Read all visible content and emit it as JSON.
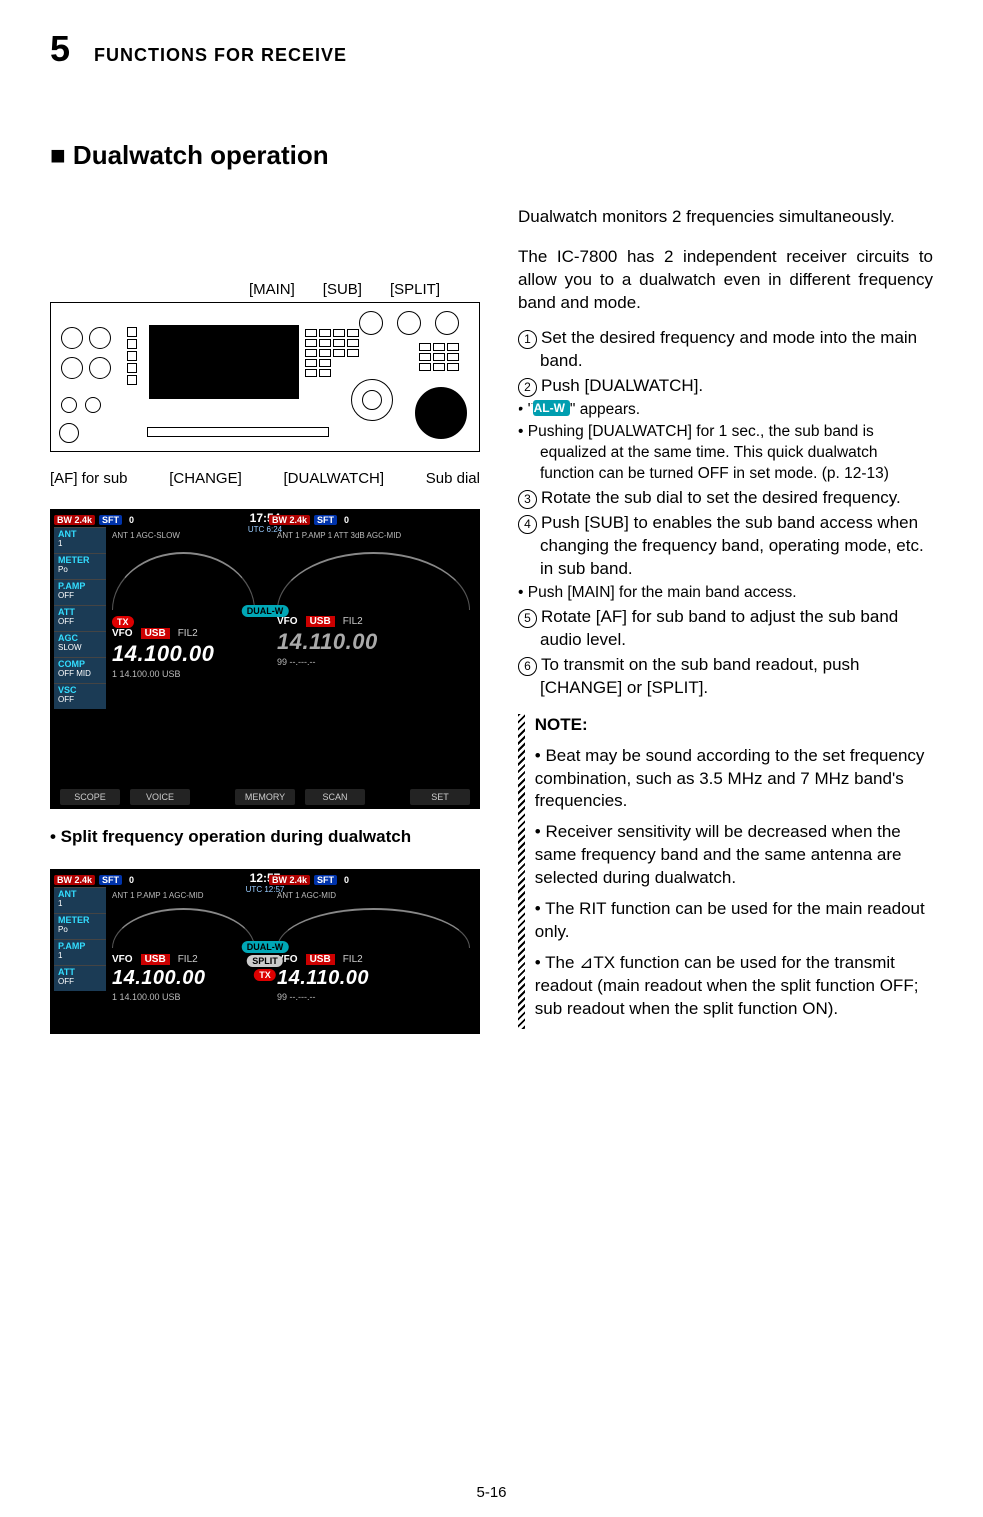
{
  "chapter": {
    "number": "5",
    "heading": "FUNCTIONS FOR RECEIVE"
  },
  "section_title": "■ Dualwatch operation",
  "labels_top": {
    "main": "[MAIN]",
    "sub": "[SUB]",
    "split": "[SPLIT]"
  },
  "labels_bot": {
    "af": "[AF] for sub",
    "change": "[CHANGE]",
    "dualwatch": "[DUALWATCH]",
    "subdial": "Sub dial"
  },
  "lcd1": {
    "clock": "17:54",
    "clock_sub": "UTC  6:24",
    "left": {
      "top": [
        "BW 2.4k",
        "SFT",
        "0"
      ],
      "info": "ANT 1               AGC-SLOW",
      "side": [
        {
          "lab": "ANT",
          "val": "1"
        },
        {
          "lab": "METER",
          "val": "Po"
        },
        {
          "lab": "P.AMP",
          "val": "OFF"
        },
        {
          "lab": "ATT",
          "val": "OFF"
        },
        {
          "lab": "AGC",
          "val": "SLOW"
        },
        {
          "lab": "COMP",
          "val": "OFF MID"
        },
        {
          "lab": "VSC",
          "val": "OFF"
        }
      ],
      "tx": "TX",
      "mode": {
        "vfo": "VFO",
        "usb": "USB",
        "fil": "FIL2"
      },
      "freq": "14.100.00",
      "sub": "1  14.100.00  USB"
    },
    "right": {
      "top": [
        "BW 2.4k",
        "SFT",
        "0"
      ],
      "info": "ANT 1      P.AMP 1  ATT 3dB      AGC-MID",
      "mode": {
        "vfo": "VFO",
        "usb": "USB",
        "fil": "FIL2"
      },
      "freq": "14.110.00",
      "sub": "99  --.---.--"
    },
    "mid_badge": "DUAL-W",
    "bottombar": [
      "SCOPE",
      "VOICE",
      "",
      "MEMORY",
      "SCAN",
      "",
      "SET"
    ]
  },
  "split_caption": "• Split frequency operation during dualwatch",
  "lcd2": {
    "clock": "12:57",
    "clock_sub": "UTC 12:57",
    "left": {
      "top": [
        "BW 2.4k",
        "SFT",
        "0"
      ],
      "info": "ANT 1      P.AMP 1         AGC-MID",
      "side": [
        {
          "lab": "ANT",
          "val": "1"
        },
        {
          "lab": "METER",
          "val": "Po"
        },
        {
          "lab": "P.AMP",
          "val": "1"
        },
        {
          "lab": "ATT",
          "val": "OFF"
        }
      ],
      "mode": {
        "vfo": "VFO",
        "usb": "USB",
        "fil": "FIL2"
      },
      "freq": "14.100.00",
      "sub": "1  14.100.00  USB"
    },
    "right": {
      "top": [
        "BW 2.4k",
        "SFT",
        "0"
      ],
      "info": "ANT 1                     AGC-MID",
      "mode": {
        "vfo": "VFO",
        "usb": "USB",
        "fil": "FIL2"
      },
      "freq": "14.110.00",
      "sub": "99  --.---.--"
    },
    "mid_badge_top": "DUAL-W",
    "mid_badge_bottom": "SPLIT",
    "tx": "TX"
  },
  "intro1": "Dualwatch monitors 2 frequencies simultaneously.",
  "intro2": "The IC-7800 has 2 independent receiver circuits to allow you to a dualwatch even in different frequency band and mode.",
  "steps": {
    "s1": "Set the desired frequency and mode into the main band.",
    "s2": "Push [DUALWATCH].",
    "s2a": "\" appears.",
    "s2aprefix": "\"",
    "s2a_badge": "DUAL-W",
    "s2b": "Pushing [DUALWATCH] for 1 sec., the sub band is equalized at the same time. This quick dualwatch function can be turned OFF in set mode. (p. 12-13)",
    "s3": "Rotate the sub dial to set the desired frequency.",
    "s4": "Push [SUB] to enables the sub band access when changing the frequency band, operating mode, etc. in sub band.",
    "s4a": "Push [MAIN] for the main band access.",
    "s5": "Rotate [AF] for sub band to adjust the sub band audio level.",
    "s6": "To transmit on the sub band readout, push [CHANGE] or [SPLIT]."
  },
  "circled": {
    "c1": "1",
    "c2": "2",
    "c3": "3",
    "c4": "4",
    "c5": "5",
    "c6": "6"
  },
  "note": {
    "head": "NOTE:",
    "n1": "Beat may be sound according to the set frequency combination, such as 3.5 MHz and 7 MHz band's frequencies.",
    "n2": "Receiver sensitivity will be decreased when the same frequency band and the same antenna are selected during dualwatch.",
    "n3": "The RIT function can be used for the main readout only.",
    "n4": "The ⊿TX function can be used for the transmit readout (main readout when the split function OFF; sub readout when the split function ON)."
  },
  "pagenum": "5-16"
}
